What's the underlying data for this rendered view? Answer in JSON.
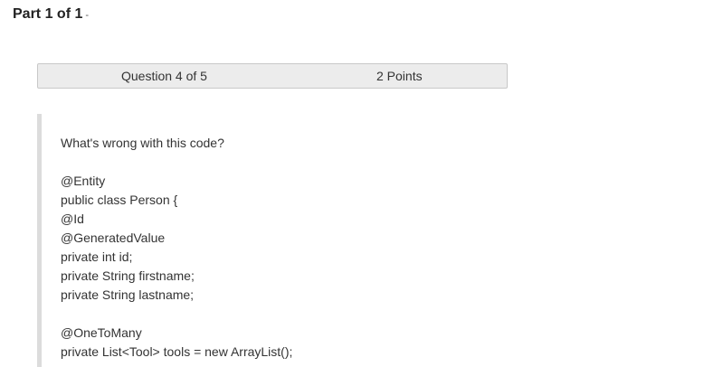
{
  "header": {
    "part_label": "Part 1 of 1",
    "part_suffix": "-"
  },
  "question_bar": {
    "number_label": "Question 4 of 5",
    "points_label": "2 Points"
  },
  "question": {
    "prompt": "What's wrong with this code?",
    "code_lines": [
      "@Entity",
      "public class Person {",
      "@Id",
      "@GeneratedValue",
      "private int id;",
      "private String firstname;",
      "private String lastname;",
      "",
      "@OneToMany",
      "private List<Tool> tools = new ArrayList();"
    ]
  }
}
